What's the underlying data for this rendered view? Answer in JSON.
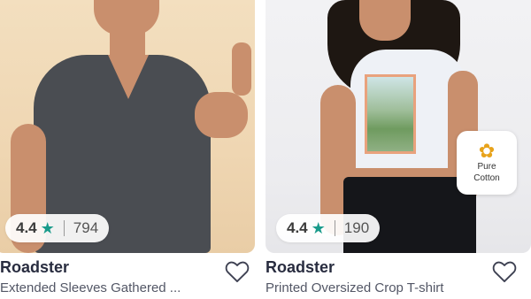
{
  "products": [
    {
      "brand": "Roadster",
      "title": "Extended Sleeves Gathered ...",
      "rating": "4.4",
      "rating_count": "794"
    },
    {
      "brand": "Roadster",
      "title": "Printed Oversized Crop T-shirt",
      "rating": "4.4",
      "rating_count": "190",
      "badge": {
        "line1": "Pure",
        "line2": "Cotton",
        "icon": "cotton-flower-icon"
      }
    }
  ],
  "colors": {
    "star": "#1a9b8b",
    "brand_text": "#282c3f",
    "title_text": "#535766"
  }
}
